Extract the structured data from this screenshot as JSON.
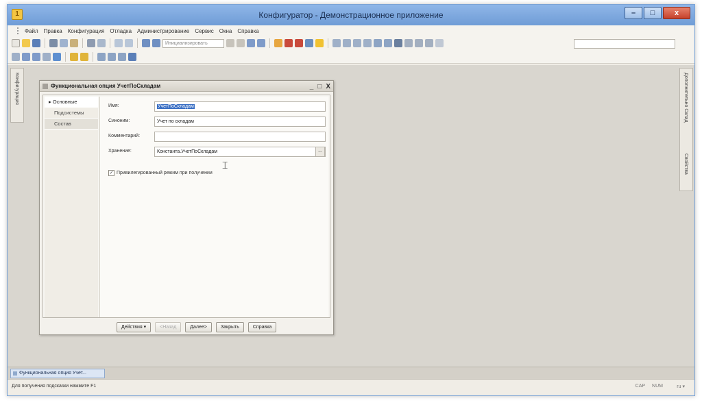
{
  "window": {
    "title": "Конфигуратор - Демонстрационное приложение",
    "controls": {
      "minimize": "–",
      "maximize": "□",
      "close": "x"
    }
  },
  "menu": [
    "Файл",
    "Правка",
    "Конфигурация",
    "Отладка",
    "Администрирование",
    "Сервис",
    "Окна",
    "Справка"
  ],
  "toolbar": {
    "combo_placeholder": "Инициализировать"
  },
  "left_panel": {
    "label": "Конфигурация"
  },
  "right_panel": {
    "label_1": "Дополнительно Склад",
    "label_2": "Свойства"
  },
  "dialog": {
    "title": "Функциональная опция УчетПоСкладам",
    "controls": {
      "minimize": "_",
      "restore": "□",
      "close": "X"
    },
    "nav": [
      "Основные",
      "Подсистемы",
      "Состав"
    ],
    "fields": {
      "name": {
        "label": "Имя:",
        "value": "УчетПоСкладам"
      },
      "synonym": {
        "label": "Синоним:",
        "value": "Учет по складам"
      },
      "comment": {
        "label": "Комментарий:",
        "value": ""
      },
      "storage": {
        "label": "Хранение:",
        "value": "Константа.УчетПоСкладам",
        "button": "..."
      }
    },
    "checkbox": {
      "label": "Привилегированный режим при получении",
      "checked": true
    },
    "buttons": {
      "actions": "Действия",
      "back": "<Назад",
      "next": "Далее>",
      "close": "Закрыть",
      "help": "Справка"
    }
  },
  "taskbar": {
    "tab": "Функциональная опция Учет..."
  },
  "status": {
    "hint": "Для получения подсказки нажмите F1",
    "cap": "CAP",
    "num": "NUM",
    "lang": "ru"
  }
}
